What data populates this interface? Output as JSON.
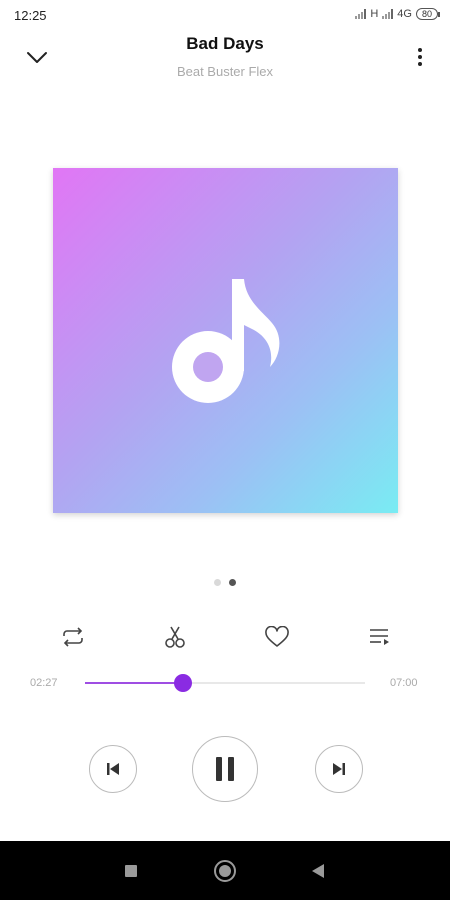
{
  "status_bar": {
    "time": "12:25",
    "network_1": "H",
    "network_2": "4G",
    "battery": "80"
  },
  "header": {
    "title": "Bad Days",
    "artist": "Beat Buster Flex",
    "back_icon": "chevron-down-icon",
    "menu_icon": "more-vertical-icon"
  },
  "album_art": {
    "icon": "music-note-icon",
    "gradient": [
      "#e176f5",
      "#b3a3f2",
      "#79ecf3"
    ]
  },
  "pager": {
    "count": 2,
    "active_index": 1
  },
  "actions": [
    {
      "icon": "repeat-icon"
    },
    {
      "icon": "scissors-icon"
    },
    {
      "icon": "heart-icon"
    },
    {
      "icon": "playlist-icon"
    }
  ],
  "progress": {
    "elapsed": "02:27",
    "total": "07:00",
    "fraction": 0.35,
    "accent_color": "#8a2be2"
  },
  "controls": {
    "previous_icon": "skip-previous-icon",
    "play_pause_icon": "pause-icon",
    "next_icon": "skip-next-icon"
  },
  "nav_bar": {
    "recents_icon": "square-icon",
    "home_icon": "circle-icon",
    "back_icon": "triangle-back-icon"
  }
}
